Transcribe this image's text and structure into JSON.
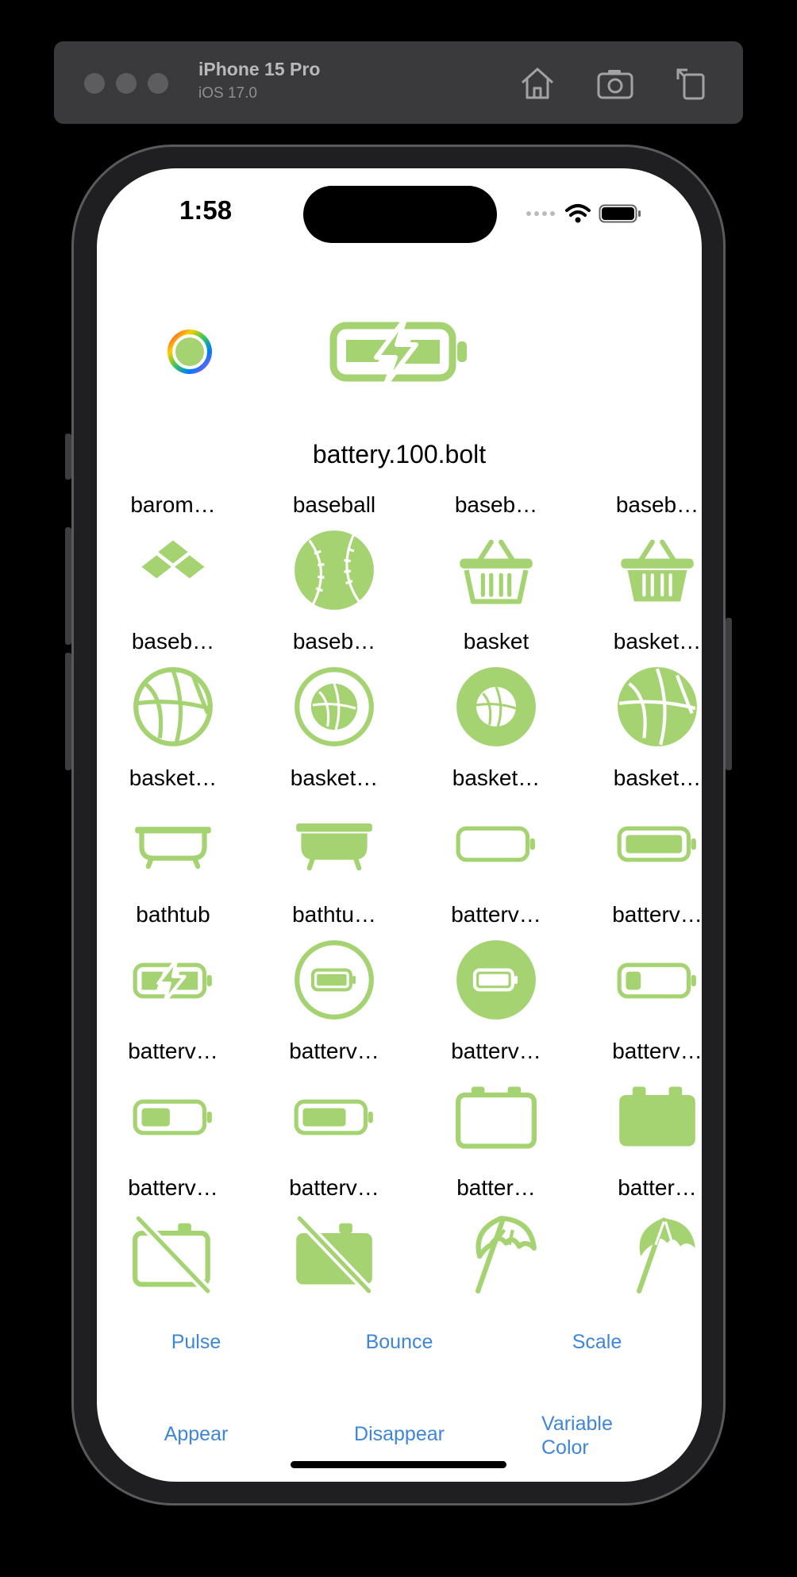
{
  "device": {
    "name": "iPhone 15 Pro",
    "os": "iOS 17.0"
  },
  "status": {
    "time": "1:58"
  },
  "selected_symbol": "battery.100.bolt",
  "accent_color": "#a6d372",
  "link_color": "#3f86d8",
  "grid": [
    {
      "label": "barom…",
      "icon": "barometer-icon"
    },
    {
      "label": "baseball",
      "icon": "baseball-icon"
    },
    {
      "label": "baseb…",
      "icon": "basket-icon"
    },
    {
      "label": "baseb…",
      "icon": "basket-fill-icon"
    },
    {
      "label": "baseb…",
      "icon": "basketball-icon"
    },
    {
      "label": "baseb…",
      "icon": "basketball-circle-icon"
    },
    {
      "label": "basket",
      "icon": "basketball-circle-fill-icon"
    },
    {
      "label": "basket…",
      "icon": "basketball-fill-icon"
    },
    {
      "label": "basket…",
      "icon": "bathtub-icon"
    },
    {
      "label": "basket…",
      "icon": "bathtub-fill-icon"
    },
    {
      "label": "basket…",
      "icon": "battery-0-icon"
    },
    {
      "label": "basket…",
      "icon": "battery-100-icon"
    },
    {
      "label": "bathtub",
      "icon": "battery-bolt-icon"
    },
    {
      "label": "bathtu…",
      "icon": "battery-circle-icon"
    },
    {
      "label": "batterv…",
      "icon": "battery-circle-fill-icon"
    },
    {
      "label": "batterv…",
      "icon": "battery-25-icon"
    },
    {
      "label": "batterv…",
      "icon": "battery-50-icon"
    },
    {
      "label": "batterv…",
      "icon": "battery-75-icon"
    },
    {
      "label": "batterv…",
      "icon": "battery-block-icon"
    },
    {
      "label": "batterv…",
      "icon": "battery-block-fill-icon"
    },
    {
      "label": "batterv…",
      "icon": "battery-block-slash-icon"
    },
    {
      "label": "batterv…",
      "icon": "battery-block-slash-fill-icon"
    },
    {
      "label": "batter…",
      "icon": "beach-umbrella-icon"
    },
    {
      "label": "batter…",
      "icon": "beach-umbrella-fill-icon"
    }
  ],
  "buttons": {
    "pulse": "Pulse",
    "bounce": "Bounce",
    "scale": "Scale",
    "appear": "Appear",
    "disappear": "Disappear",
    "variable_1": "Variable",
    "variable_2": "Color"
  }
}
